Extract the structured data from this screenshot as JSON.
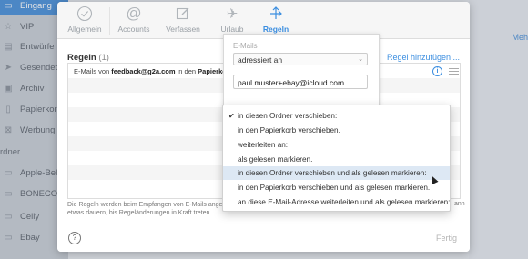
{
  "sidebar": {
    "items": [
      {
        "label": "Eingang",
        "icon": "inbox-icon",
        "active": true
      },
      {
        "label": "VIP",
        "icon": "star-icon"
      },
      {
        "label": "Entwürfe",
        "icon": "draft-icon"
      },
      {
        "label": "Gesendet",
        "icon": "paper-plane-icon"
      },
      {
        "label": "Archiv",
        "icon": "archive-box-icon"
      },
      {
        "label": "Papierkorb",
        "icon": "trash-icon"
      },
      {
        "label": "Werbung",
        "icon": "junk-icon"
      }
    ],
    "section_label": "rdner",
    "folders": [
      {
        "label": "Apple-Bele",
        "icon": "folder-icon"
      },
      {
        "label": "BONECO",
        "icon": "folder-icon"
      },
      {
        "label": "Celly",
        "icon": "folder-icon"
      },
      {
        "label": "Ebay",
        "icon": "folder-icon"
      }
    ]
  },
  "background": {
    "mehr": "Meh"
  },
  "modal": {
    "tabs": [
      {
        "label": "Allgemein",
        "icon": "checkmark-circle-icon"
      },
      {
        "label": "Accounts",
        "icon": "at-sign-icon"
      },
      {
        "label": "Verfassen",
        "icon": "compose-icon"
      },
      {
        "label": "Urlaub",
        "icon": "airplane-icon"
      },
      {
        "label": "Regeln",
        "icon": "rules-arrows-icon",
        "selected": true
      }
    ],
    "rules_title": "Regeln",
    "rules_count": "(1)",
    "add_rule": "Regel hinzufügen ...",
    "rule": {
      "prefix": "E-Mails von",
      "sender": "feedback@g2a.com",
      "middle": "in den",
      "folder": "Papierkorb"
    },
    "footer_text": "Die Regeln werden beim Empfangen von E-Mails angewe etwas dauern, bis Regeländerungen in Kraft treten.",
    "footer_right": "ann",
    "done_label": "Fertig",
    "help_label": "?"
  },
  "edit_panel": {
    "field_label": "E-Mails",
    "condition_value": "adressiert an",
    "email_value": "paul.muster+ebay@icloud.com"
  },
  "menu": {
    "items": [
      {
        "label": "in diesen Ordner verschieben:",
        "checked": true
      },
      {
        "label": "in den Papierkorb verschieben."
      },
      {
        "label": "weiterleiten an:"
      },
      {
        "label": "als gelesen markieren."
      },
      {
        "label": "in diesen Ordner verschieben und als gelesen markieren:",
        "highlighted": true
      },
      {
        "label": "in den Papierkorb verschieben und als gelesen markieren."
      },
      {
        "label": "an diese E-Mail-Adresse weiterleiten und als gelesen markieren:"
      }
    ],
    "check_glyph": "✔"
  },
  "colors": {
    "accent": "#3b8ee0",
    "sidebar_active": "#4a90d9",
    "highlight": "#dde8f4"
  }
}
